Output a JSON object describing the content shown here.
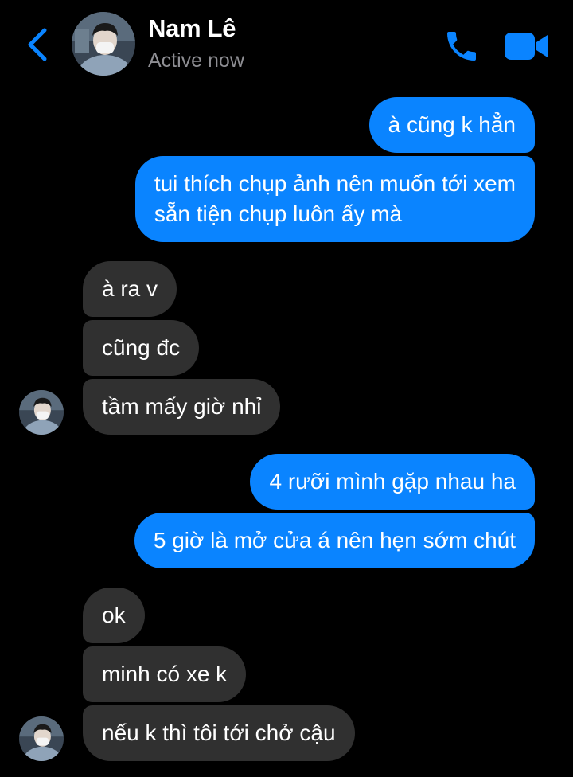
{
  "contact": {
    "name": "Nam Lê",
    "status": "Active now"
  },
  "icons": {
    "back": "chevron-left-icon",
    "call": "phone-icon",
    "video": "video-camera-icon",
    "avatar": "avatar"
  },
  "colors": {
    "background": "#000000",
    "accent": "#0a84ff",
    "outgoing_bubble": "#0a84ff",
    "incoming_bubble": "#303030",
    "status_text": "#8e8e93"
  },
  "messages": [
    {
      "from": "me",
      "text": "à cũng k hẳn"
    },
    {
      "from": "me",
      "lines": [
        "tui thích chụp ảnh nên muốn tới xem",
        "sẵn tiện chụp luôn ấy mà"
      ]
    },
    {
      "from": "them",
      "text": "à ra v"
    },
    {
      "from": "them",
      "text": "cũng đc"
    },
    {
      "from": "them",
      "text": "tầm mấy giờ nhỉ"
    },
    {
      "from": "me",
      "text": "4 rưỡi mình gặp nhau ha"
    },
    {
      "from": "me",
      "text": "5 giờ là mở cửa á nên hẹn sớm chút"
    },
    {
      "from": "them",
      "text": "ok"
    },
    {
      "from": "them",
      "text": "minh có xe k"
    },
    {
      "from": "them",
      "text": "nếu k thì tôi tới chở cậu"
    }
  ]
}
